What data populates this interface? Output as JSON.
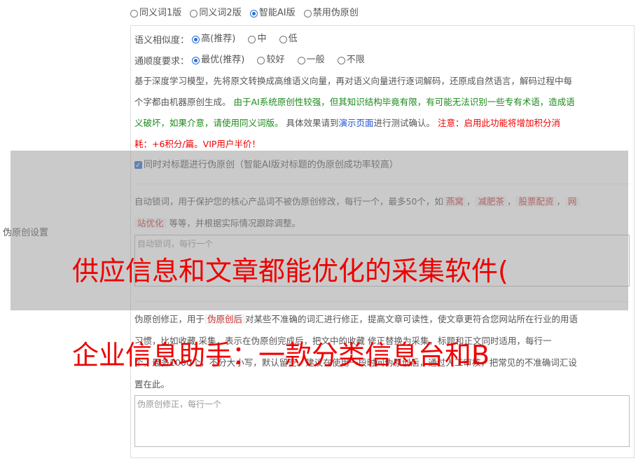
{
  "versions": [
    {
      "label": "同义词1版",
      "checked": false
    },
    {
      "label": "同义词2版",
      "checked": false
    },
    {
      "label": "智能AI版",
      "checked": true
    },
    {
      "label": "禁用伪原创",
      "checked": false
    }
  ],
  "similarity": {
    "label": "语义相似度：",
    "options": [
      {
        "label": "高(推荐)",
        "checked": true
      },
      {
        "label": "中",
        "checked": false
      },
      {
        "label": "低",
        "checked": false
      }
    ]
  },
  "fluency": {
    "label": "通顺度要求：",
    "options": [
      {
        "label": "最优(推荐)",
        "checked": true
      },
      {
        "label": "较好",
        "checked": false
      },
      {
        "label": "一般",
        "checked": false
      },
      {
        "label": "不限",
        "checked": false
      }
    ]
  },
  "description": {
    "line1": "基于深度学习模型，先将原文转换成高维语义向量，再对语义向量进行逐词解码，还原成自然语言，解码过程中每",
    "line2_plain": "个字都由机器原创生成。",
    "line2_green": "由于AI系统原创性较强，但其知识结构毕竟有限，有可能无法识别一些专有术语，造成语",
    "line3_green": "义破坏，如果介意，请使用同义词版。",
    "line3_plain1": "具体效果请到",
    "line3_link": "演示页面",
    "line3_plain2": "进行测试确认。",
    "line3_red": "注意：启用此功能将增加积分消",
    "line4_red": "耗：+6积分/篇。VIP用户半价！"
  },
  "side_label": "伪原创设置",
  "title_checkbox": {
    "label": "同时对标题进行伪原创（智能AI版对标题的伪原创成功率较高）",
    "checked": true
  },
  "lock_words": {
    "desc_prefix": "自动锁词，用于保护您的核心产品词不被伪原创修改，每行一个，最多50个，如",
    "tags": [
      "燕窝",
      "减肥茶",
      "股票配资",
      "网"
    ],
    "sep": "，",
    "line2_tag": "站优化",
    "line2_rest": "等等，并根据实际情况跟踪调整。",
    "placeholder": "自动锁词，每行一个"
  },
  "correction": {
    "line1_prefix": "伪原创修正，用于",
    "line1_tag": "伪原创后",
    "line1_rest": "对某些不准确的词汇进行修正，提高文章可读性，使文章更符合您网站所在行业的用语",
    "line2": "习惯，比如收藏 采集，表示在伪原创完成后，把文中的收藏 修正替换为采集，标题和正文同时适用，每行一",
    "line3": "个，最多1000个，不分大小写，默认留空。建议在使用一段时间伪原创后，通过人工审核，把常见的不准确词汇设",
    "line4": "置在此。",
    "placeholder": "伪原创修正，每行一个"
  },
  "overlay_text": {
    "line1": "供应信息和文章都能优化的采集软件(",
    "line2": "企业信息助手：一款分类信息台和B"
  }
}
